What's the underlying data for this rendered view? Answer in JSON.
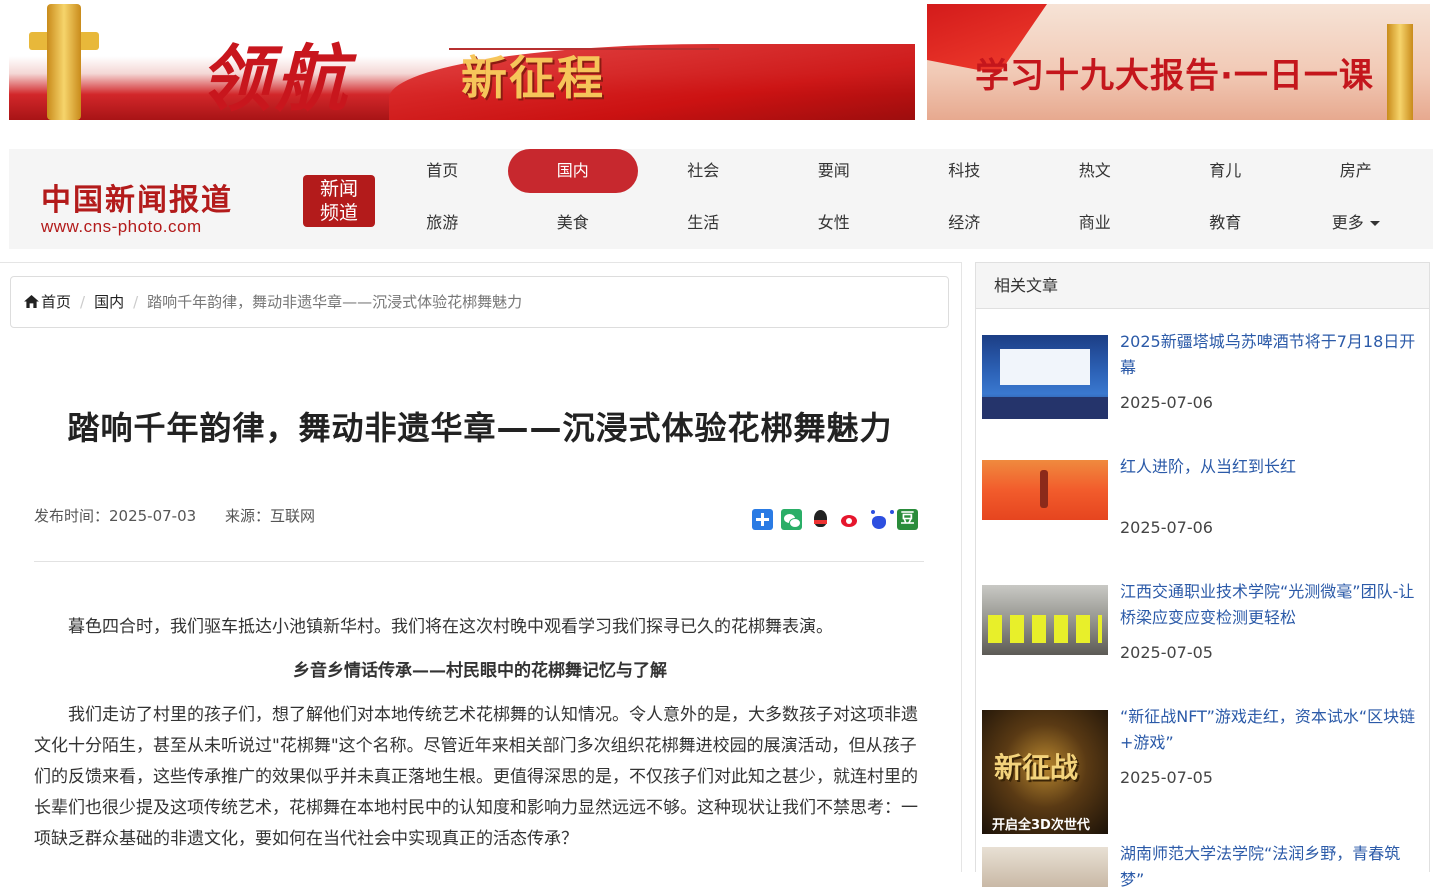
{
  "banners": {
    "left": {
      "calligraphy": "领航",
      "subtitle": "新征程"
    },
    "right": {
      "title": "学习十九大报告·一日一课"
    }
  },
  "site": {
    "logo_cn": "中国新闻报道",
    "logo_url": "www.cns-photo.com",
    "logo_badge_line1": "新闻",
    "logo_badge_line2": "频道"
  },
  "nav": {
    "row1": [
      "首页",
      "国内",
      "社会",
      "要闻",
      "科技",
      "热文",
      "育儿",
      "房产"
    ],
    "row2": [
      "旅游",
      "美食",
      "生活",
      "女性",
      "经济",
      "商业",
      "教育",
      "更多"
    ],
    "active": "国内"
  },
  "breadcrumb": {
    "home": "首页",
    "section": "国内",
    "current": "踏响千年韵律，舞动非遗华章——沉浸式体验花梆舞魅力"
  },
  "article": {
    "title": "踏响千年韵律，舞动非遗华章——沉浸式体验花梆舞魅力",
    "publish_time": "发布时间：2025-07-03",
    "source": "来源：互联网",
    "p1": "暮色四合时，我们驱车抵达小池镇新华村。我们将在这次村晚中观看学习我们探寻已久的花梆舞表演。",
    "subheading": "乡音乡情话传承——村民眼中的花梆舞记忆与了解",
    "p2": "我们走访了村里的孩子们，想了解他们对本地传统艺术花梆舞的认知情况。令人意外的是，大多数孩子对这项非遗文化十分陌生，甚至从未听说过\"花梆舞\"这个名称。尽管近年来相关部门多次组织花梆舞进校园的展演活动，但从孩子们的反馈来看，这些传承推广的效果似乎并未真正落地生根。更值得深思的是，不仅孩子们对此知之甚少，就连村里的长辈们也很少提及这项传统艺术，花梆舞在本地村民中的认知度和影响力显然远远不够。这种现状让我们不禁思考：一项缺乏群众基础的非遗文化，要如何在当代社会中实现真正的活态传承？"
  },
  "sidebar": {
    "heading": "相关文章",
    "items": [
      {
        "title": "2025新疆塔城乌苏啤酒节将于7月18日开幕",
        "date": "2025-07-06"
      },
      {
        "title": "红人进阶，从当红到长红",
        "date": "2025-07-06"
      },
      {
        "title": "江西交通职业技术学院“光测微毫”团队-让桥梁应变应变检测更轻松",
        "date": "2025-07-05"
      },
      {
        "title": "“新征战NFT”游戏走红，资本试水“区块链+游戏”",
        "date": "2025-07-05"
      },
      {
        "title": "湖南师范大学法学院“法润乡野，青春筑梦”",
        "date": ""
      }
    ]
  },
  "colors": {
    "accent": "#c7282e",
    "link": "#2b5aa8"
  }
}
